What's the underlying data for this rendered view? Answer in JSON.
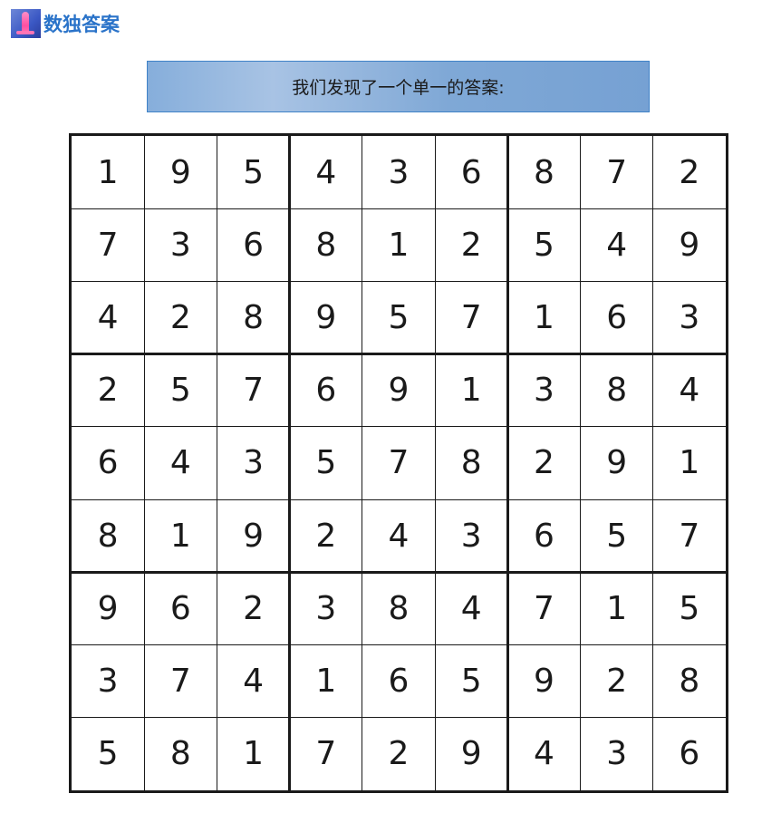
{
  "header": {
    "logo_icon": "sudoku-logo-icon",
    "title": "数独答案"
  },
  "banner": {
    "text": "我们发现了一个单一的答案:"
  },
  "colors": {
    "title": "#2a73c9",
    "banner_border": "#3f82c7",
    "grid_line": "#1a1a1a"
  },
  "sudoku": {
    "grid": [
      [
        "1",
        "9",
        "5",
        "4",
        "3",
        "6",
        "8",
        "7",
        "2"
      ],
      [
        "7",
        "3",
        "6",
        "8",
        "1",
        "2",
        "5",
        "4",
        "9"
      ],
      [
        "4",
        "2",
        "8",
        "9",
        "5",
        "7",
        "1",
        "6",
        "3"
      ],
      [
        "2",
        "5",
        "7",
        "6",
        "9",
        "1",
        "3",
        "8",
        "4"
      ],
      [
        "6",
        "4",
        "3",
        "5",
        "7",
        "8",
        "2",
        "9",
        "1"
      ],
      [
        "8",
        "1",
        "9",
        "2",
        "4",
        "3",
        "6",
        "5",
        "7"
      ],
      [
        "9",
        "6",
        "2",
        "3",
        "8",
        "4",
        "7",
        "1",
        "5"
      ],
      [
        "3",
        "7",
        "4",
        "1",
        "6",
        "5",
        "9",
        "2",
        "8"
      ],
      [
        "5",
        "8",
        "1",
        "7",
        "2",
        "9",
        "4",
        "3",
        "6"
      ]
    ]
  }
}
